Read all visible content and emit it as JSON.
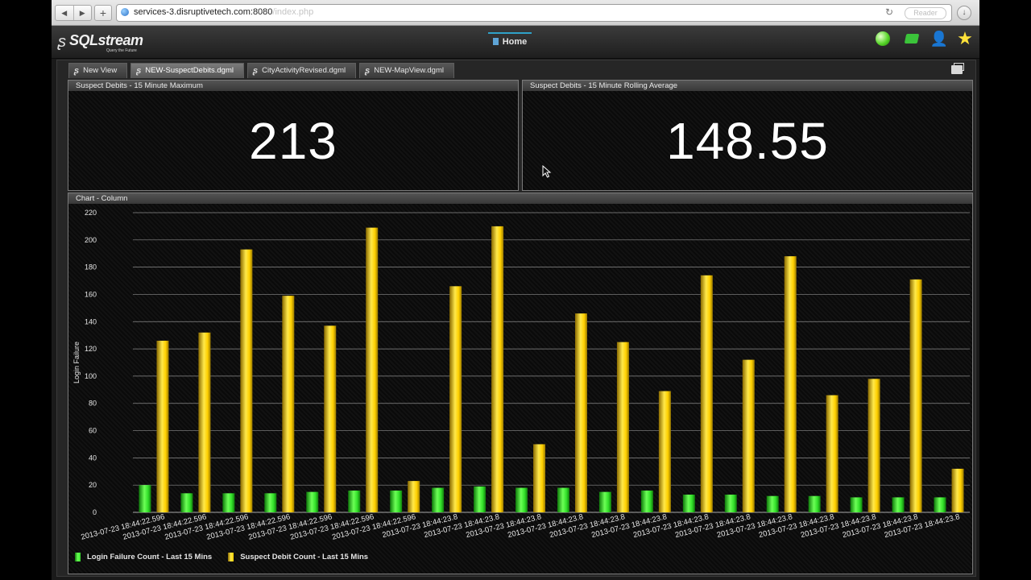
{
  "browser": {
    "url_host": "services-3.disruptivetech.com:8080",
    "url_path": "/index.php",
    "reader_label": "Reader"
  },
  "app": {
    "logo_text": "SQLstream",
    "logo_tagline": "Query the Future",
    "home_label": "Home"
  },
  "tabs": [
    {
      "label": "New View"
    },
    {
      "label": "NEW-SuspectDebits.dgml"
    },
    {
      "label": "CityActivityRevised.dgml"
    },
    {
      "label": "NEW-MapView.dgml"
    }
  ],
  "panels": {
    "max": {
      "title": "Suspect Debits - 15 Minute Maximum",
      "value": "213"
    },
    "avg": {
      "title": "Suspect Debits - 15 Minute Rolling Average",
      "value": "148.55"
    },
    "chart": {
      "title": "Chart - Column"
    }
  },
  "colors": {
    "login_failure": "#33e02a",
    "suspect_debit": "#ffd200"
  },
  "chart_data": {
    "type": "bar",
    "ylabel": "Login Failure",
    "ylim": [
      0,
      220
    ],
    "yticks": [
      0,
      20,
      40,
      60,
      80,
      100,
      120,
      140,
      160,
      180,
      200,
      220
    ],
    "grid": true,
    "legend_position": "bottom-left",
    "categories": [
      "2013-07-23 18:44:22.596",
      "2013-07-23 18:44:22.596",
      "2013-07-23 18:44:22.596",
      "2013-07-23 18:44:22.596",
      "2013-07-23 18:44:22.596",
      "2013-07-23 18:44:22.596",
      "2013-07-23 18:44:22.596",
      "2013-07-23 18:44:23.8",
      "2013-07-23 18:44:23.8",
      "2013-07-23 18:44:23.8",
      "2013-07-23 18:44:23.8",
      "2013-07-23 18:44:23.8",
      "2013-07-23 18:44:23.8",
      "2013-07-23 18:44:23.8",
      "2013-07-23 18:44:23.8",
      "2013-07-23 18:44:23.8",
      "2013-07-23 18:44:23.8",
      "2013-07-23 18:44:23.8",
      "2013-07-23 18:44:23.8",
      "2013-07-23 18:44:23.8"
    ],
    "series": [
      {
        "name": "Login Failure Count - Last 15 Mins",
        "values": [
          20,
          14,
          14,
          14,
          15,
          16,
          16,
          18,
          19,
          18,
          18,
          15,
          16,
          13,
          13,
          12,
          12,
          11,
          11,
          11
        ]
      },
      {
        "name": "Suspect Debit Count - Last 15 Mins",
        "values": [
          126,
          132,
          193,
          159,
          137,
          209,
          23,
          166,
          210,
          50,
          146,
          125,
          89,
          174,
          112,
          188,
          86,
          98,
          171,
          32
        ]
      }
    ]
  }
}
